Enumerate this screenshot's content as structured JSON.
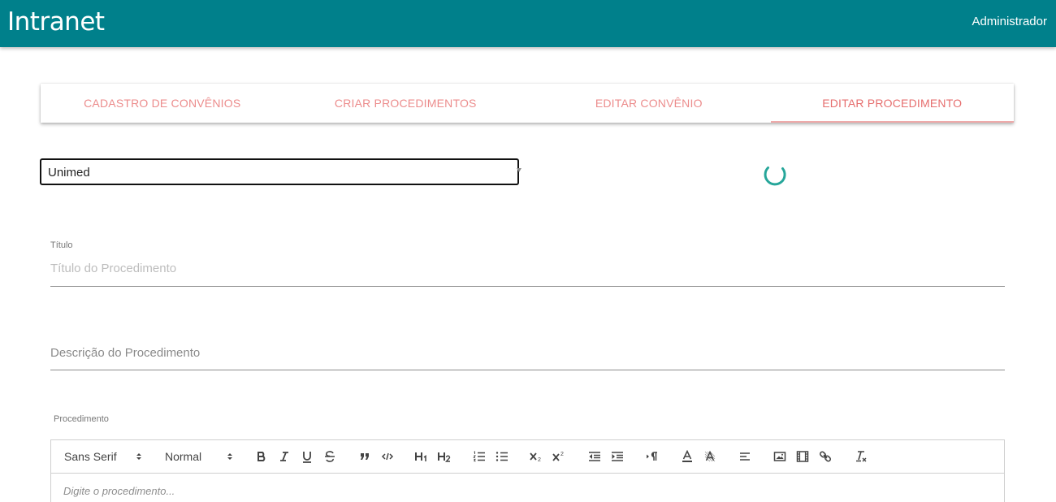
{
  "app": {
    "title": "Intranet",
    "user": "Administrador"
  },
  "tabs": [
    {
      "label": "CADASTRO DE CONVÊNIOS",
      "active": false
    },
    {
      "label": "CRIAR PROCEDIMENTOS",
      "active": false
    },
    {
      "label": "EDITAR CONVÊNIO",
      "active": false
    },
    {
      "label": "EDITAR PROCEDIMENTO",
      "active": true
    }
  ],
  "convenio_select": {
    "value": "Unimed"
  },
  "titulo": {
    "label": "Título",
    "placeholder": "Título do Procedimento"
  },
  "descricao": {
    "placeholder": "Descrição do Procedimento"
  },
  "procedimento": {
    "label": "Procedimento",
    "font_picker": "Sans Serif",
    "size_picker": "Normal",
    "placeholder": "Digite o procedimento..."
  },
  "colors": {
    "appbar": "#00808b",
    "tab_text": "#ec8c8c",
    "spinner": "#26a69a"
  },
  "icons": {
    "loading": "spinner-icon",
    "toolbar": [
      "bold-icon",
      "italic-icon",
      "underline-icon",
      "strike-icon",
      "blockquote-icon",
      "code-block-icon",
      "header1-icon",
      "header2-icon",
      "ordered-list-icon",
      "bullet-list-icon",
      "subscript-icon",
      "superscript-icon",
      "outdent-icon",
      "indent-icon",
      "text-direction-icon",
      "text-color-icon",
      "background-color-icon",
      "align-icon",
      "image-icon",
      "video-icon",
      "link-icon",
      "clean-format-icon"
    ]
  }
}
